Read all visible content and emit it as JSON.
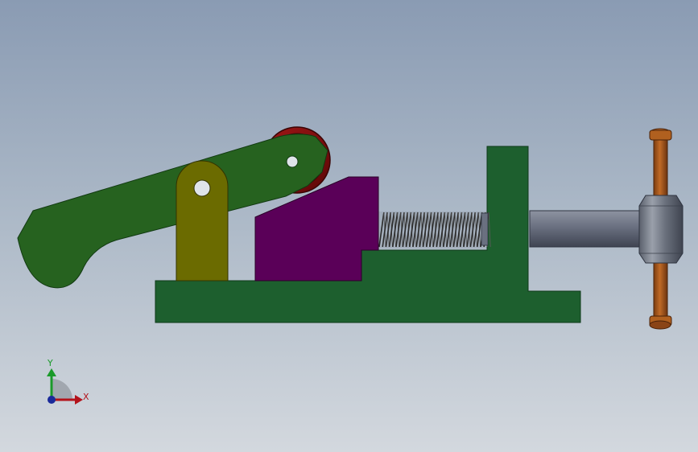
{
  "triad": {
    "x_label": "X",
    "y_label": "Y"
  },
  "colors": {
    "base": "#1d5f2e",
    "lever": "#26621f",
    "link": "#6b6b00",
    "block": "#5a0058",
    "roller": "#7d0a0a",
    "spring": "#3a3a3a",
    "screw": "#5e6472",
    "handle_bar": "#a0551c",
    "axis_x": "#b3131b",
    "axis_y": "#1a9a2a",
    "axis_z": "#1a2a9a"
  },
  "parts": [
    {
      "name": "base",
      "label": ""
    },
    {
      "name": "vertical-jaw",
      "label": ""
    },
    {
      "name": "lever",
      "label": ""
    },
    {
      "name": "link",
      "label": ""
    },
    {
      "name": "wedge-block",
      "label": ""
    },
    {
      "name": "roller",
      "label": ""
    },
    {
      "name": "spring",
      "label": ""
    },
    {
      "name": "screw",
      "label": ""
    },
    {
      "name": "handle",
      "label": ""
    }
  ]
}
